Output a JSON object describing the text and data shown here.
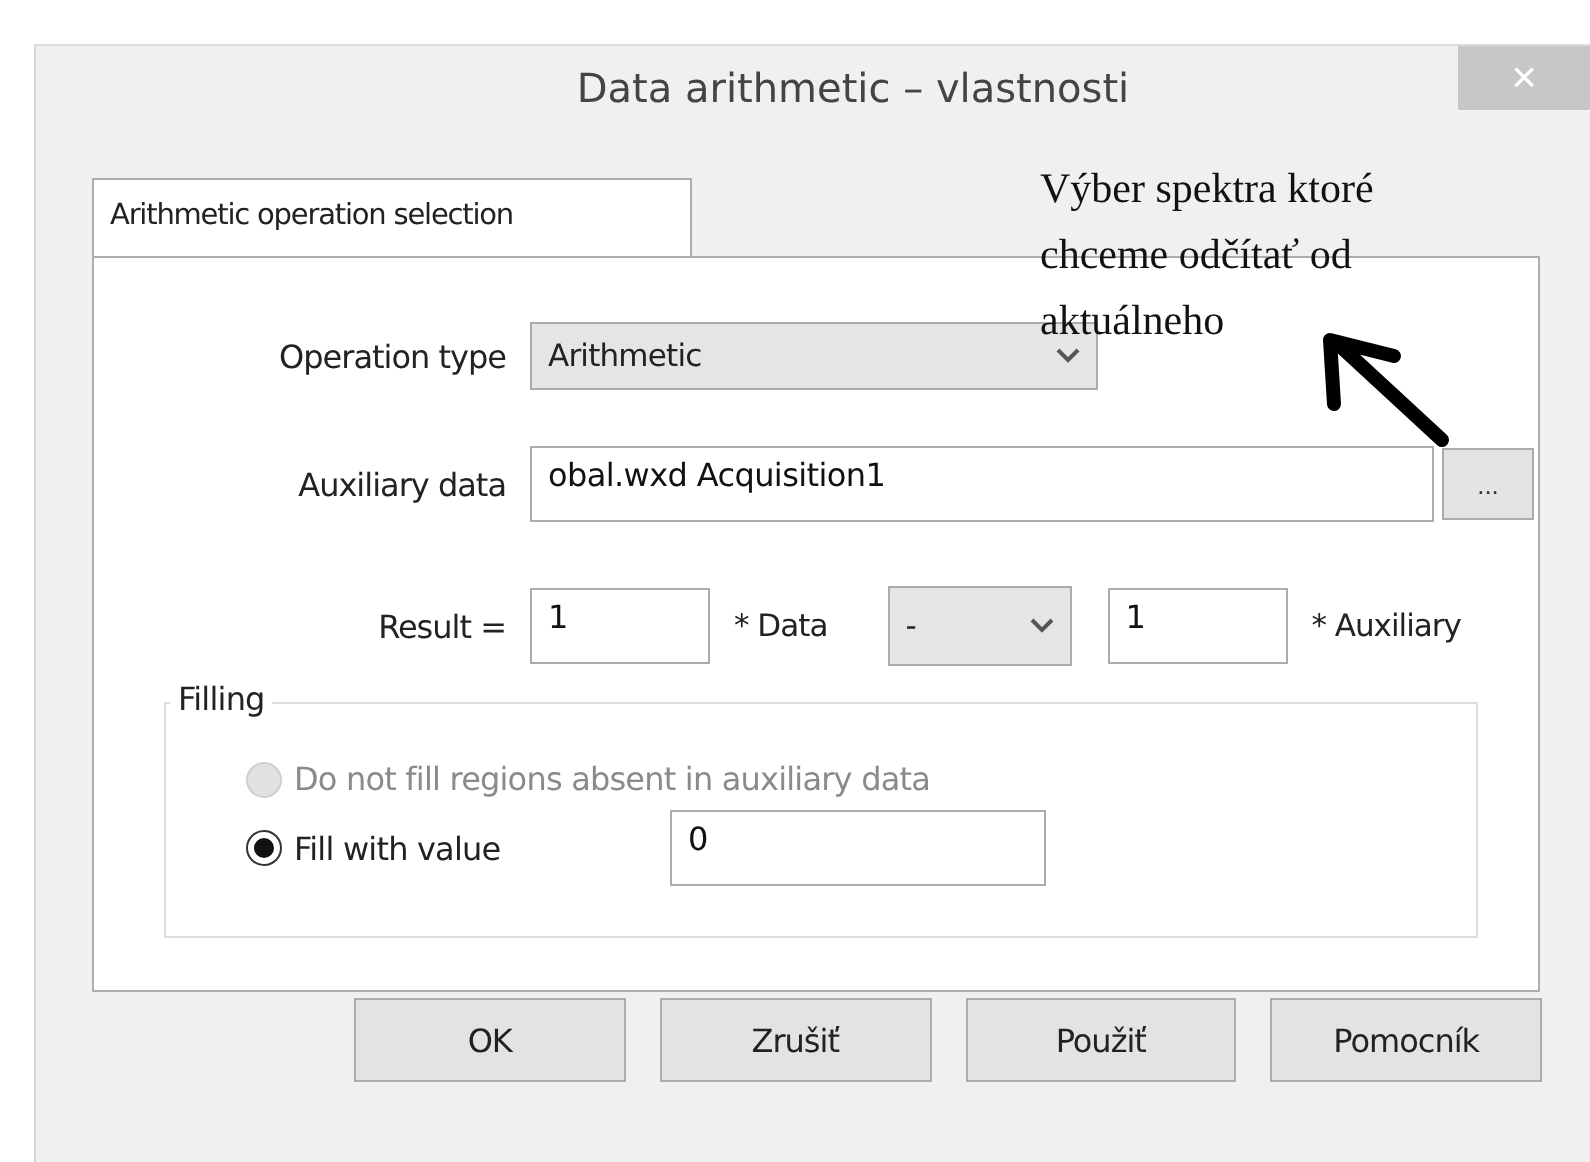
{
  "window": {
    "title": "Data arithmetic – vlastnosti",
    "close": "×"
  },
  "tabs": [
    {
      "label": "Arithmetic operation selection",
      "selected": true
    }
  ],
  "operation_type": {
    "label": "Operation type",
    "value": "Arithmetic"
  },
  "auxiliary_data": {
    "label": "Auxiliary data",
    "value": "obal.wxd Acquisition1",
    "browse": "..."
  },
  "result": {
    "label": "Result =",
    "data_factor": "1",
    "data_label": "* Data",
    "operator": "-",
    "aux_factor": "1",
    "aux_label": "* Auxiliary"
  },
  "filling": {
    "title": "Filling",
    "options": [
      {
        "label": "Do not fill regions absent in auxiliary data",
        "selected": false,
        "disabled": true
      },
      {
        "label": "Fill with value",
        "selected": true,
        "disabled": false
      }
    ],
    "value": "0"
  },
  "annotation": "Výber spektra ktoré chceme odčítať od aktuálneho",
  "buttons": [
    "OK",
    "Zrušiť",
    "Použiť",
    "Pomocník"
  ]
}
